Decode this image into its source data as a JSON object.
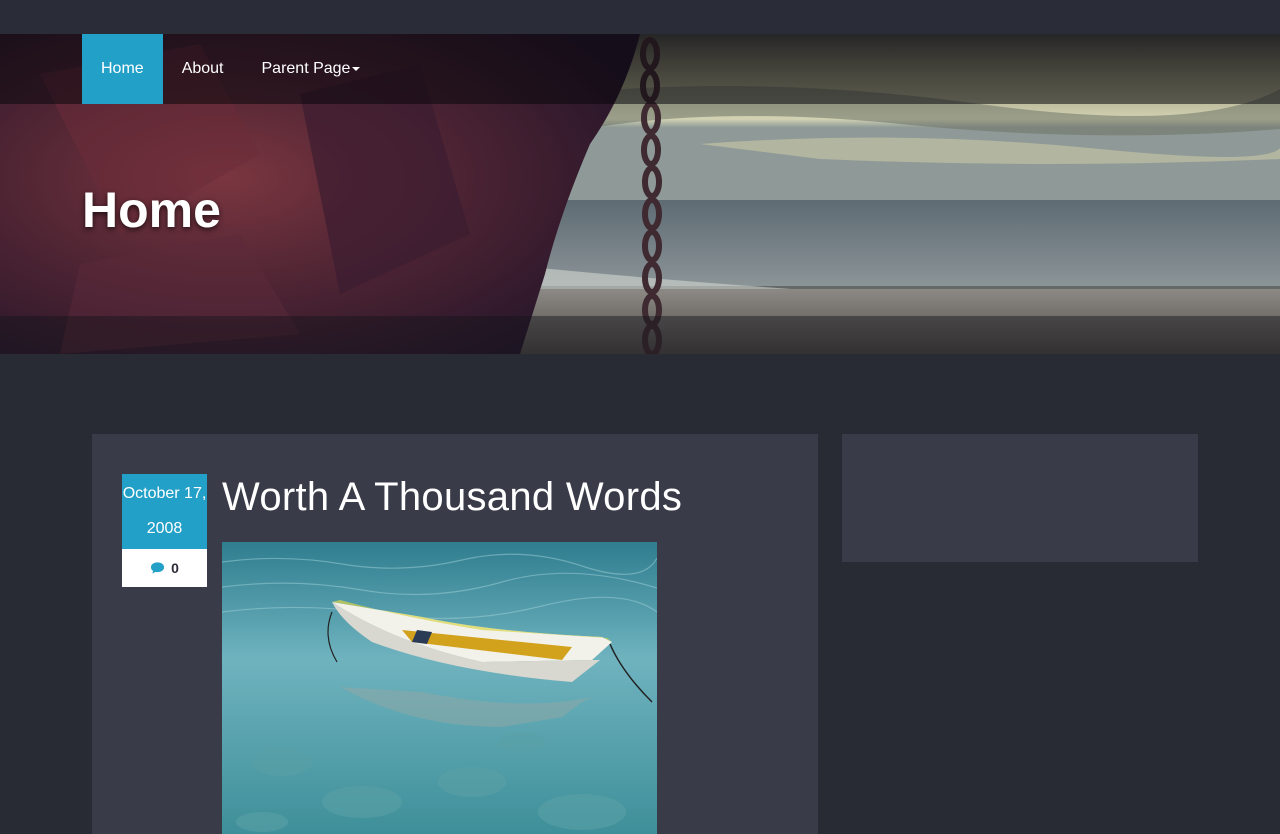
{
  "nav": {
    "items": [
      {
        "label": "Home",
        "active": true
      },
      {
        "label": "About",
        "active": false
      },
      {
        "label": "Parent Page",
        "active": false,
        "dropdown": true
      }
    ]
  },
  "hero": {
    "title": "Home"
  },
  "post": {
    "date_line1": "October 17,",
    "date_line2": "2008",
    "comment_count": "0",
    "comment_icon": "comment-icon",
    "title": "Worth A Thousand Words"
  },
  "colors": {
    "accent": "#23a0c8",
    "page_bg": "#282b34",
    "card_bg": "#393b48"
  }
}
